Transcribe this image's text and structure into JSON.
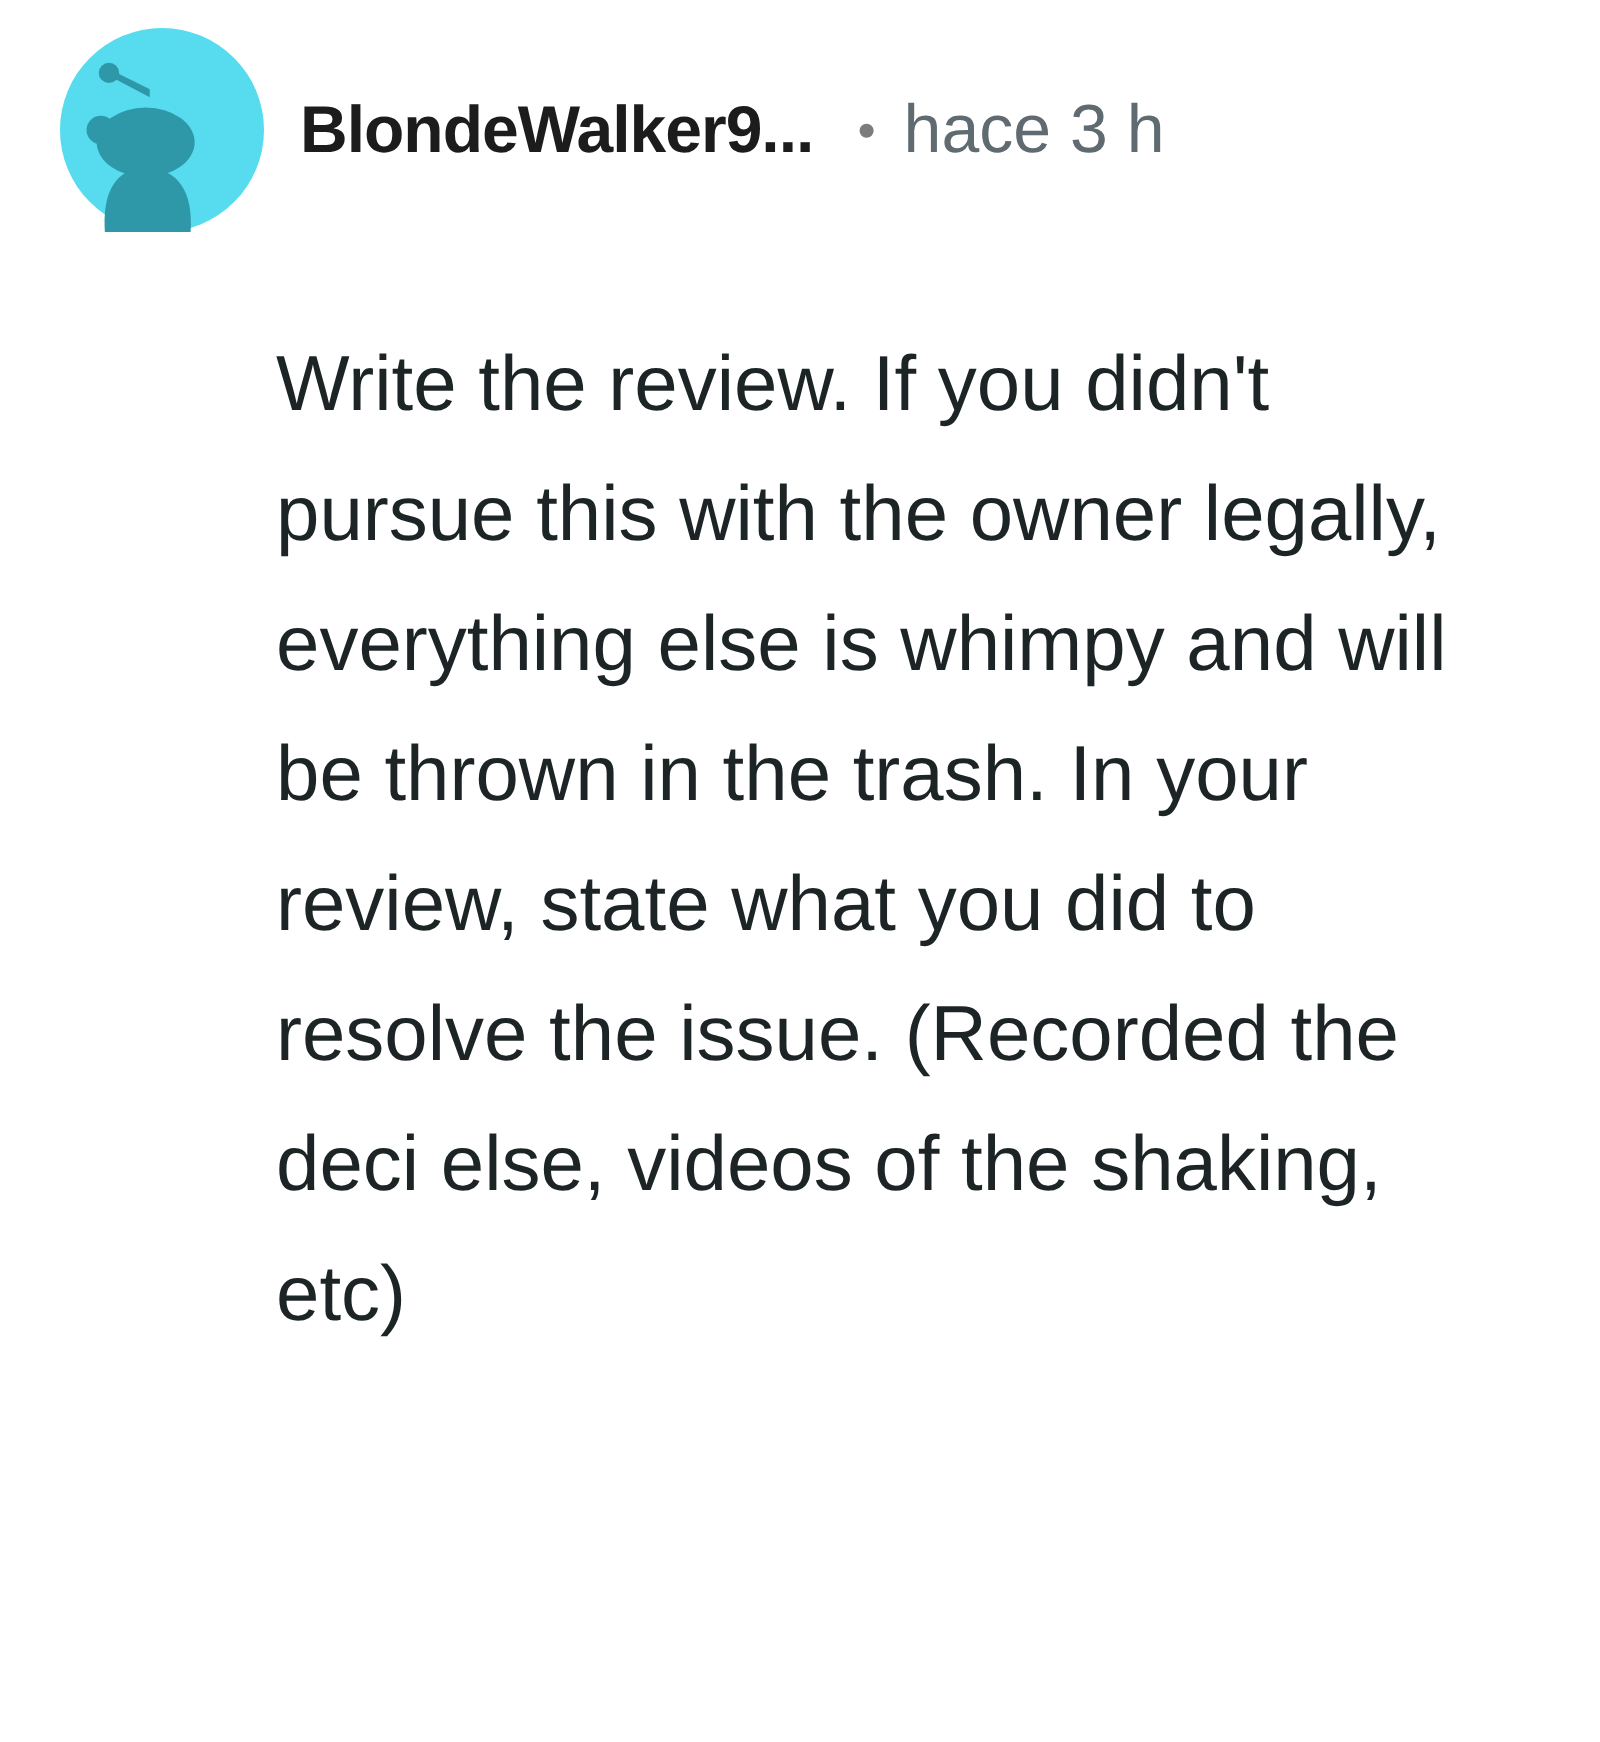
{
  "comment": {
    "author": "BlondeWalker9...",
    "separator": "•",
    "time": "hace 3 h",
    "body": "Write the review. If you didn't pursue this with the owner legally, everything else is whimpy and will be thrown in the trash. In your review, state what you did to resolve the issue. (Recorded the deci else, videos of the shaking, etc)"
  }
}
